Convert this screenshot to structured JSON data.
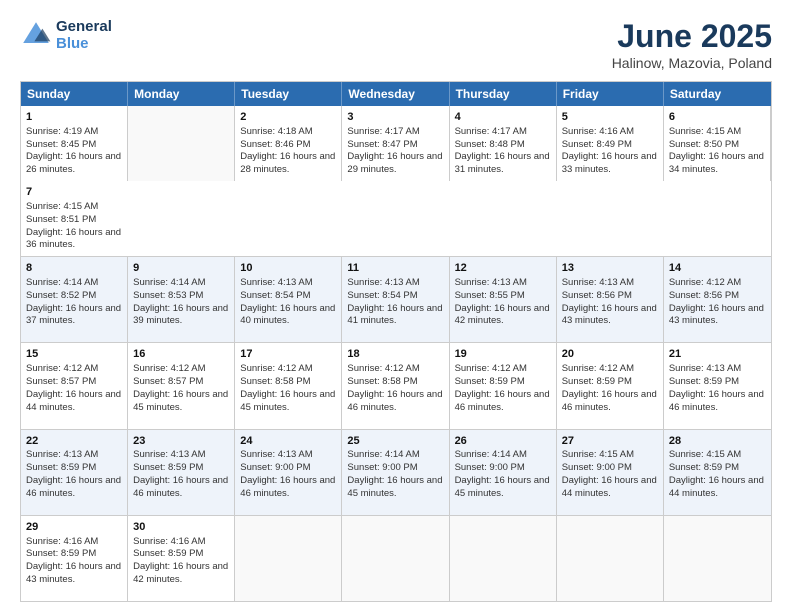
{
  "header": {
    "logo_line1": "General",
    "logo_line2": "Blue",
    "title": "June 2025",
    "subtitle": "Halinow, Mazovia, Poland"
  },
  "weekdays": [
    "Sunday",
    "Monday",
    "Tuesday",
    "Wednesday",
    "Thursday",
    "Friday",
    "Saturday"
  ],
  "rows": [
    [
      {
        "day": "",
        "sunrise": "",
        "sunset": "",
        "daylight": "",
        "empty": true
      },
      {
        "day": "2",
        "sunrise": "Sunrise: 4:18 AM",
        "sunset": "Sunset: 8:46 PM",
        "daylight": "Daylight: 16 hours and 28 minutes."
      },
      {
        "day": "3",
        "sunrise": "Sunrise: 4:17 AM",
        "sunset": "Sunset: 8:47 PM",
        "daylight": "Daylight: 16 hours and 29 minutes."
      },
      {
        "day": "4",
        "sunrise": "Sunrise: 4:17 AM",
        "sunset": "Sunset: 8:48 PM",
        "daylight": "Daylight: 16 hours and 31 minutes."
      },
      {
        "day": "5",
        "sunrise": "Sunrise: 4:16 AM",
        "sunset": "Sunset: 8:49 PM",
        "daylight": "Daylight: 16 hours and 33 minutes."
      },
      {
        "day": "6",
        "sunrise": "Sunrise: 4:15 AM",
        "sunset": "Sunset: 8:50 PM",
        "daylight": "Daylight: 16 hours and 34 minutes."
      },
      {
        "day": "7",
        "sunrise": "Sunrise: 4:15 AM",
        "sunset": "Sunset: 8:51 PM",
        "daylight": "Daylight: 16 hours and 36 minutes."
      }
    ],
    [
      {
        "day": "8",
        "sunrise": "Sunrise: 4:14 AM",
        "sunset": "Sunset: 8:52 PM",
        "daylight": "Daylight: 16 hours and 37 minutes."
      },
      {
        "day": "9",
        "sunrise": "Sunrise: 4:14 AM",
        "sunset": "Sunset: 8:53 PM",
        "daylight": "Daylight: 16 hours and 39 minutes."
      },
      {
        "day": "10",
        "sunrise": "Sunrise: 4:13 AM",
        "sunset": "Sunset: 8:54 PM",
        "daylight": "Daylight: 16 hours and 40 minutes."
      },
      {
        "day": "11",
        "sunrise": "Sunrise: 4:13 AM",
        "sunset": "Sunset: 8:54 PM",
        "daylight": "Daylight: 16 hours and 41 minutes."
      },
      {
        "day": "12",
        "sunrise": "Sunrise: 4:13 AM",
        "sunset": "Sunset: 8:55 PM",
        "daylight": "Daylight: 16 hours and 42 minutes."
      },
      {
        "day": "13",
        "sunrise": "Sunrise: 4:13 AM",
        "sunset": "Sunset: 8:56 PM",
        "daylight": "Daylight: 16 hours and 43 minutes."
      },
      {
        "day": "14",
        "sunrise": "Sunrise: 4:12 AM",
        "sunset": "Sunset: 8:56 PM",
        "daylight": "Daylight: 16 hours and 43 minutes."
      }
    ],
    [
      {
        "day": "15",
        "sunrise": "Sunrise: 4:12 AM",
        "sunset": "Sunset: 8:57 PM",
        "daylight": "Daylight: 16 hours and 44 minutes."
      },
      {
        "day": "16",
        "sunrise": "Sunrise: 4:12 AM",
        "sunset": "Sunset: 8:57 PM",
        "daylight": "Daylight: 16 hours and 45 minutes."
      },
      {
        "day": "17",
        "sunrise": "Sunrise: 4:12 AM",
        "sunset": "Sunset: 8:58 PM",
        "daylight": "Daylight: 16 hours and 45 minutes."
      },
      {
        "day": "18",
        "sunrise": "Sunrise: 4:12 AM",
        "sunset": "Sunset: 8:58 PM",
        "daylight": "Daylight: 16 hours and 46 minutes."
      },
      {
        "day": "19",
        "sunrise": "Sunrise: 4:12 AM",
        "sunset": "Sunset: 8:59 PM",
        "daylight": "Daylight: 16 hours and 46 minutes."
      },
      {
        "day": "20",
        "sunrise": "Sunrise: 4:12 AM",
        "sunset": "Sunset: 8:59 PM",
        "daylight": "Daylight: 16 hours and 46 minutes."
      },
      {
        "day": "21",
        "sunrise": "Sunrise: 4:13 AM",
        "sunset": "Sunset: 8:59 PM",
        "daylight": "Daylight: 16 hours and 46 minutes."
      }
    ],
    [
      {
        "day": "22",
        "sunrise": "Sunrise: 4:13 AM",
        "sunset": "Sunset: 8:59 PM",
        "daylight": "Daylight: 16 hours and 46 minutes."
      },
      {
        "day": "23",
        "sunrise": "Sunrise: 4:13 AM",
        "sunset": "Sunset: 8:59 PM",
        "daylight": "Daylight: 16 hours and 46 minutes."
      },
      {
        "day": "24",
        "sunrise": "Sunrise: 4:13 AM",
        "sunset": "Sunset: 9:00 PM",
        "daylight": "Daylight: 16 hours and 46 minutes."
      },
      {
        "day": "25",
        "sunrise": "Sunrise: 4:14 AM",
        "sunset": "Sunset: 9:00 PM",
        "daylight": "Daylight: 16 hours and 45 minutes."
      },
      {
        "day": "26",
        "sunrise": "Sunrise: 4:14 AM",
        "sunset": "Sunset: 9:00 PM",
        "daylight": "Daylight: 16 hours and 45 minutes."
      },
      {
        "day": "27",
        "sunrise": "Sunrise: 4:15 AM",
        "sunset": "Sunset: 9:00 PM",
        "daylight": "Daylight: 16 hours and 44 minutes."
      },
      {
        "day": "28",
        "sunrise": "Sunrise: 4:15 AM",
        "sunset": "Sunset: 8:59 PM",
        "daylight": "Daylight: 16 hours and 44 minutes."
      }
    ],
    [
      {
        "day": "29",
        "sunrise": "Sunrise: 4:16 AM",
        "sunset": "Sunset: 8:59 PM",
        "daylight": "Daylight: 16 hours and 43 minutes."
      },
      {
        "day": "30",
        "sunrise": "Sunrise: 4:16 AM",
        "sunset": "Sunset: 8:59 PM",
        "daylight": "Daylight: 16 hours and 42 minutes."
      },
      {
        "day": "",
        "sunrise": "",
        "sunset": "",
        "daylight": "",
        "empty": true
      },
      {
        "day": "",
        "sunrise": "",
        "sunset": "",
        "daylight": "",
        "empty": true
      },
      {
        "day": "",
        "sunrise": "",
        "sunset": "",
        "daylight": "",
        "empty": true
      },
      {
        "day": "",
        "sunrise": "",
        "sunset": "",
        "daylight": "",
        "empty": true
      },
      {
        "day": "",
        "sunrise": "",
        "sunset": "",
        "daylight": "",
        "empty": true
      }
    ]
  ],
  "first_row_special": {
    "day1": {
      "day": "1",
      "sunrise": "Sunrise: 4:19 AM",
      "sunset": "Sunset: 8:45 PM",
      "daylight": "Daylight: 16 hours and 26 minutes."
    }
  }
}
